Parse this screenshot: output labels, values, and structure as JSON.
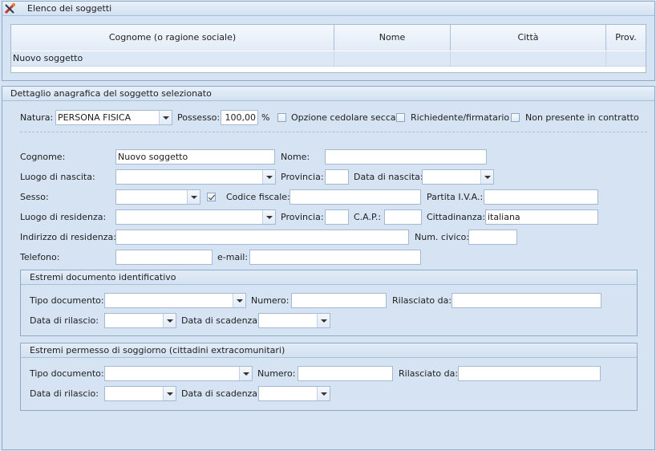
{
  "list_panel": {
    "title": "Elenco dei soggetti",
    "columns": [
      "Cognome (o ragione sociale)",
      "Nome",
      "Città",
      "Prov."
    ],
    "rows": [
      {
        "cognome": "Nuovo soggetto",
        "nome": "",
        "citta": "",
        "prov": ""
      }
    ]
  },
  "detail_panel": {
    "title": "Dettaglio anagrafica del soggetto selezionato",
    "natura_label": "Natura:",
    "natura_value": "PERSONA FISICA",
    "possesso_label": "Possesso:",
    "possesso_value": "100,00",
    "percent": "%",
    "cedolare_label": "Opzione cedolare secca",
    "richiedente_label": "Richiedente/firmatario",
    "non_presente_label": "Non presente in contratto",
    "cognome_label": "Cognome:",
    "cognome_value": "Nuovo soggetto",
    "nome_label": "Nome:",
    "nome_value": "",
    "luogo_nascita_label": "Luogo di nascita:",
    "provincia_label": "Provincia:",
    "data_nascita_label": "Data di nascita:",
    "sesso_label": "Sesso:",
    "codice_fiscale_label": "Codice fiscale:",
    "piva_label": "Partita I.V.A.:",
    "luogo_residenza_label": "Luogo di residenza:",
    "provincia2_label": "Provincia:",
    "cap_label": "C.A.P.:",
    "cittadinanza_label": "Cittadinanza:",
    "cittadinanza_value": "italiana",
    "indirizzo_label": "Indirizzo di residenza:",
    "num_civico_label": "Num. civico:",
    "telefono_label": "Telefono:",
    "email_label": "e-mail:"
  },
  "doc_group": {
    "title": "Estremi documento identificativo",
    "tipo_label": "Tipo documento:",
    "numero_label": "Numero:",
    "rilasciato_label": "Rilasciato da:",
    "data_rilascio_label": "Data di rilascio:",
    "data_scadenza_label": "Data di scadenza:"
  },
  "permesso_group": {
    "title": "Estremi permesso di soggiorno (cittadini extracomunitari)",
    "tipo_label": "Tipo documento:",
    "numero_label": "Numero:",
    "rilasciato_label": "Rilasciato da:",
    "data_rilascio_label": "Data di rilascio:",
    "data_scadenza_label": "Data di scadenza:"
  },
  "icons": {
    "panel_icon": "tools-icon"
  },
  "colors": {
    "background": "#d5e3f2",
    "border": "#8fa9c8",
    "selected_row": "#dde8f6"
  }
}
